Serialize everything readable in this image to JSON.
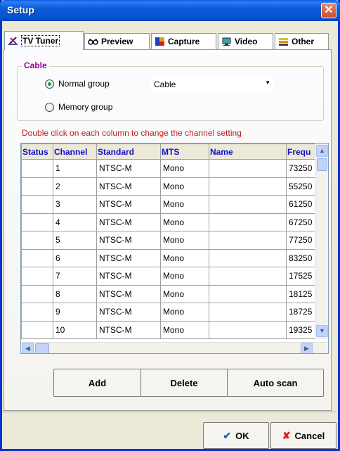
{
  "window": {
    "title": "Setup"
  },
  "tabs": [
    {
      "label": "TV Tuner",
      "icon": "tv-tuner-icon"
    },
    {
      "label": "Preview",
      "icon": "glasses-icon"
    },
    {
      "label": "Capture",
      "icon": "capture-icon"
    },
    {
      "label": "Video",
      "icon": "monitor-icon"
    },
    {
      "label": "Other",
      "icon": "other-icon"
    }
  ],
  "cable": {
    "group_label": "Cable",
    "normal_group_label": "Normal group",
    "memory_group_label": "Memory group",
    "selected_option": "Cable"
  },
  "hint": "Double click on each column to change the channel setting",
  "table": {
    "columns": [
      "Status",
      "Channel",
      "Standard",
      "MTS",
      "Name",
      "Frequ"
    ],
    "rows": [
      {
        "status": "",
        "channel": "1",
        "standard": "NTSC-M",
        "mts": "Mono",
        "name": "",
        "freq": "73250"
      },
      {
        "status": "",
        "channel": "2",
        "standard": "NTSC-M",
        "mts": "Mono",
        "name": "",
        "freq": "55250"
      },
      {
        "status": "",
        "channel": "3",
        "standard": "NTSC-M",
        "mts": "Mono",
        "name": "",
        "freq": "61250"
      },
      {
        "status": "",
        "channel": "4",
        "standard": "NTSC-M",
        "mts": "Mono",
        "name": "",
        "freq": "67250"
      },
      {
        "status": "",
        "channel": "5",
        "standard": "NTSC-M",
        "mts": "Mono",
        "name": "",
        "freq": "77250"
      },
      {
        "status": "",
        "channel": "6",
        "standard": "NTSC-M",
        "mts": "Mono",
        "name": "",
        "freq": "83250"
      },
      {
        "status": "",
        "channel": "7",
        "standard": "NTSC-M",
        "mts": "Mono",
        "name": "",
        "freq": "17525"
      },
      {
        "status": "",
        "channel": "8",
        "standard": "NTSC-M",
        "mts": "Mono",
        "name": "",
        "freq": "18125"
      },
      {
        "status": "",
        "channel": "9",
        "standard": "NTSC-M",
        "mts": "Mono",
        "name": "",
        "freq": "18725"
      },
      {
        "status": "",
        "channel": "10",
        "standard": "NTSC-M",
        "mts": "Mono",
        "name": "",
        "freq": "19325"
      }
    ]
  },
  "buttons": {
    "add": "Add",
    "delete": "Delete",
    "auto_scan": "Auto scan"
  },
  "footer": {
    "ok": "OK",
    "cancel": "Cancel"
  },
  "colors": {
    "title_bar": "#0550d0",
    "group_title": "#990099",
    "hint": "#c02020",
    "header_text": "#1010d0"
  }
}
